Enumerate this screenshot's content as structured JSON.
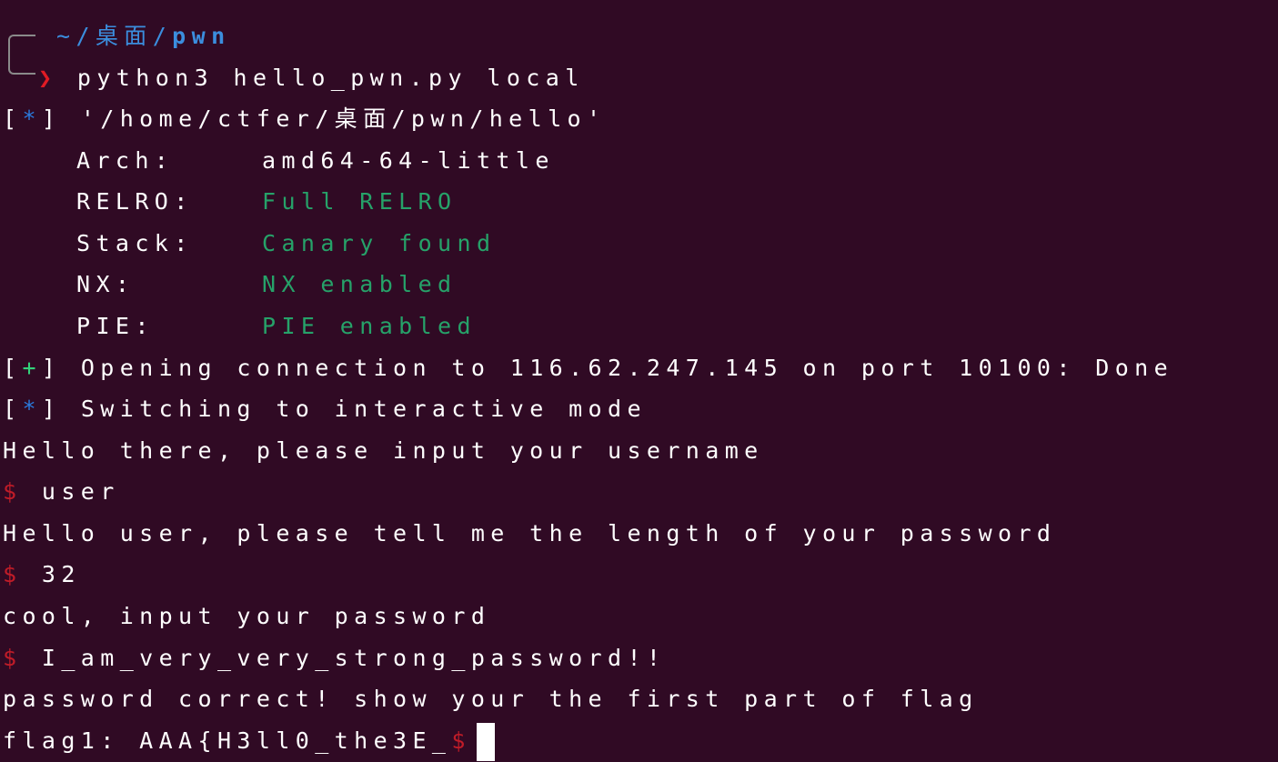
{
  "prompt": {
    "tilde": "~",
    "sep1": "/",
    "dir1": "桌面",
    "sep2": "/",
    "dir2": "pwn",
    "arrow": "❯",
    "command": "python3 hello_pwn.py local"
  },
  "checksec": {
    "marker_open": "[",
    "marker_symbol": "*",
    "marker_close": "]",
    "path": "'/home/ctfer/桌面/pwn/hello'",
    "rows": [
      {
        "key": "Arch:",
        "value": "amd64-64-little"
      },
      {
        "key": "RELRO:",
        "value": "Full RELRO"
      },
      {
        "key": "Stack:",
        "value": "Canary found"
      },
      {
        "key": "NX:",
        "value": "NX enabled"
      },
      {
        "key": "PIE:",
        "value": "PIE enabled"
      }
    ]
  },
  "status": [
    {
      "open": "[",
      "symbol": "+",
      "close": "]",
      "text": "Opening connection to 116.62.247.145 on port 10100: Done"
    },
    {
      "open": "[",
      "symbol": "*",
      "close": "]",
      "text": "Switching to interactive mode"
    }
  ],
  "session": {
    "line1": "Hello there, please input your username",
    "prompt_symbol": "$",
    "input1": "user",
    "line2": "Hello user, please tell me the length of your password",
    "input2": "32",
    "line3": "cool, input your password",
    "input3": "I_am_very_very_strong_password!!",
    "line4": "password correct! show your the first part of flag",
    "flag_text": "flag1: AAA{H3ll0_the3E_"
  },
  "colors": {
    "background": "#300a24",
    "foreground": "#ffffff",
    "green": "#26a269",
    "blue": "#2a7bde",
    "red": "#c01c28"
  }
}
